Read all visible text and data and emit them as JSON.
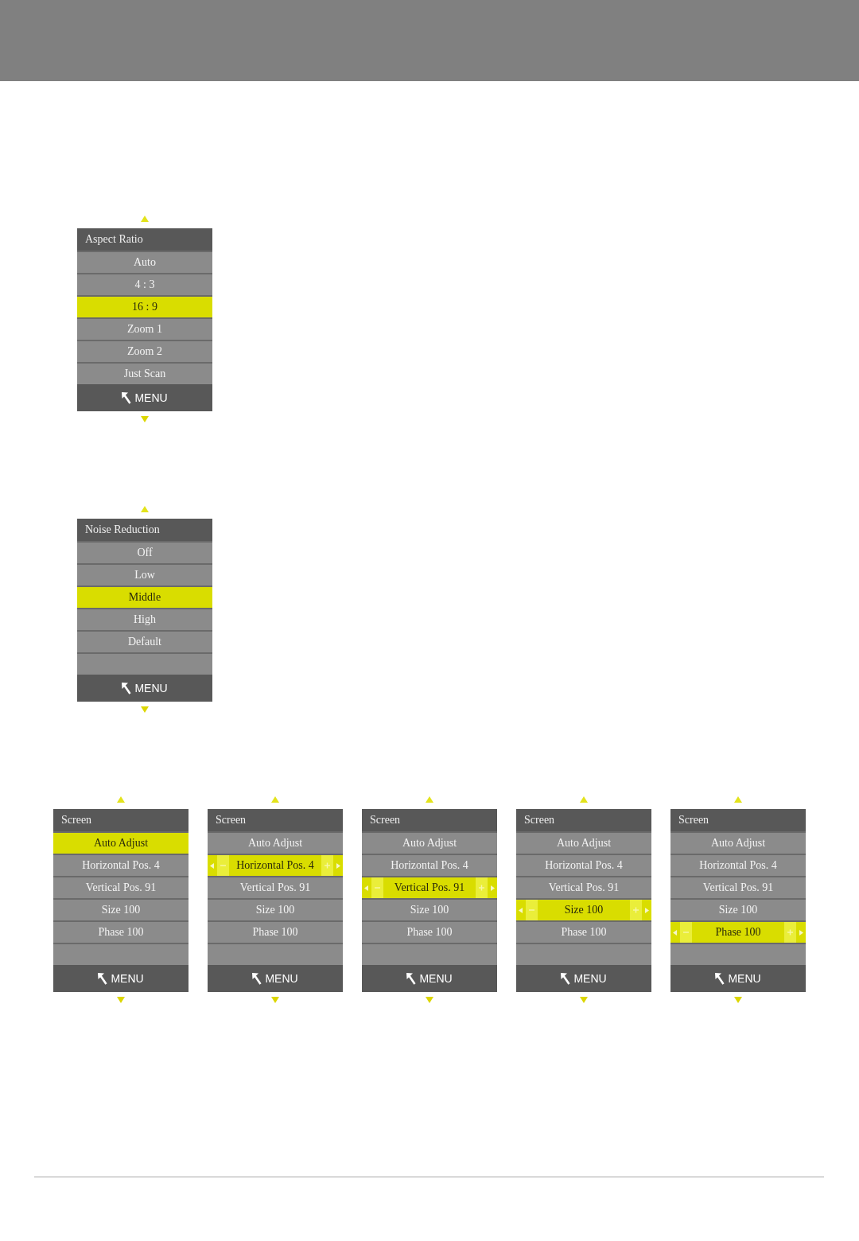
{
  "figures": [
    {
      "menus": [
        {
          "title": "Aspect Ratio",
          "items": [
            {
              "label": "Auto",
              "selected": false
            },
            {
              "label": "4 : 3",
              "selected": false
            },
            {
              "label": "16 : 9",
              "selected": true
            },
            {
              "label": "Zoom 1",
              "selected": false
            },
            {
              "label": "Zoom 2",
              "selected": false
            },
            {
              "label": "Just Scan",
              "selected": false
            }
          ],
          "footer": "MENU"
        }
      ]
    },
    {
      "menus": [
        {
          "title": "Noise Reduction",
          "items": [
            {
              "label": "Off",
              "selected": false
            },
            {
              "label": "Low",
              "selected": false
            },
            {
              "label": "Middle",
              "selected": true
            },
            {
              "label": "High",
              "selected": false
            },
            {
              "label": "Default",
              "selected": false
            }
          ],
          "footer": "MENU"
        }
      ]
    },
    {
      "menus": [
        {
          "title": "Screen",
          "items": [
            {
              "label": "Auto Adjust",
              "selected": true,
              "adjusting": false
            },
            {
              "label": "Horizontal Pos. 4",
              "selected": false,
              "adjusting": false
            },
            {
              "label": "Vertical Pos. 91",
              "selected": false,
              "adjusting": false
            },
            {
              "label": "Size 100",
              "selected": false,
              "adjusting": false
            },
            {
              "label": "Phase 100",
              "selected": false,
              "adjusting": false
            }
          ],
          "footer": "MENU"
        },
        {
          "title": "Screen",
          "items": [
            {
              "label": "Auto Adjust",
              "selected": false,
              "adjusting": false
            },
            {
              "label": "Horizontal Pos. 4",
              "selected": true,
              "adjusting": true
            },
            {
              "label": "Vertical Pos. 91",
              "selected": false,
              "adjusting": false
            },
            {
              "label": "Size 100",
              "selected": false,
              "adjusting": false
            },
            {
              "label": "Phase 100",
              "selected": false,
              "adjusting": false
            }
          ],
          "footer": "MENU"
        },
        {
          "title": "Screen",
          "items": [
            {
              "label": "Auto Adjust",
              "selected": false,
              "adjusting": false
            },
            {
              "label": "Horizontal Pos. 4",
              "selected": false,
              "adjusting": false
            },
            {
              "label": "Vertical Pos. 91",
              "selected": true,
              "adjusting": true
            },
            {
              "label": "Size 100",
              "selected": false,
              "adjusting": false
            },
            {
              "label": "Phase 100",
              "selected": false,
              "adjusting": false
            }
          ],
          "footer": "MENU"
        },
        {
          "title": "Screen",
          "items": [
            {
              "label": "Auto Adjust",
              "selected": false,
              "adjusting": false
            },
            {
              "label": "Horizontal Pos. 4",
              "selected": false,
              "adjusting": false
            },
            {
              "label": "Vertical Pos. 91",
              "selected": false,
              "adjusting": false
            },
            {
              "label": "Size 100",
              "selected": true,
              "adjusting": true
            },
            {
              "label": "Phase 100",
              "selected": false,
              "adjusting": false
            }
          ],
          "footer": "MENU"
        },
        {
          "title": "Screen",
          "items": [
            {
              "label": "Auto Adjust",
              "selected": false,
              "adjusting": false
            },
            {
              "label": "Horizontal Pos. 4",
              "selected": false,
              "adjusting": false
            },
            {
              "label": "Vertical Pos. 91",
              "selected": false,
              "adjusting": false
            },
            {
              "label": "Size 100",
              "selected": false,
              "adjusting": false
            },
            {
              "label": "Phase 100",
              "selected": true,
              "adjusting": true
            }
          ],
          "footer": "MENU"
        }
      ]
    }
  ]
}
